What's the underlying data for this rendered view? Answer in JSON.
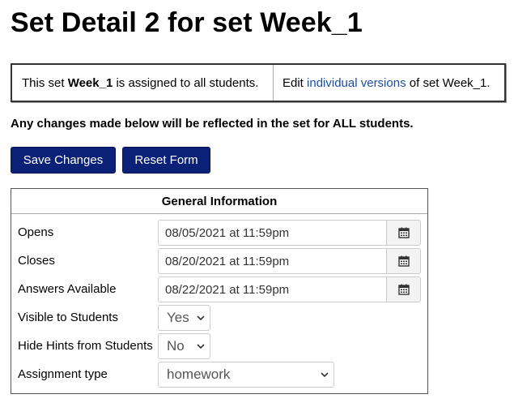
{
  "page": {
    "title": "Set Detail 2 for set Week_1"
  },
  "assignment": {
    "text_before": "This set ",
    "set_name": "Week_1",
    "text_after": " is assigned to all students.",
    "edit_prefix": "Edit ",
    "edit_link": "individual versions",
    "edit_suffix": " of set Week_1."
  },
  "notice": "Any changes made below will be reflected in the set for ALL students.",
  "buttons": {
    "save": "Save Changes",
    "reset": "Reset Form"
  },
  "general_info": {
    "header": "General Information",
    "opens": {
      "label": "Opens",
      "value": "08/05/2021 at 11:59pm"
    },
    "closes": {
      "label": "Closes",
      "value": "08/20/2021 at 11:59pm"
    },
    "answers": {
      "label": "Answers Available",
      "value": "08/22/2021 at 11:59pm"
    },
    "visible": {
      "label": "Visible to Students",
      "value": "Yes"
    },
    "hide_hints": {
      "label": "Hide Hints from Students",
      "value": "No"
    },
    "assignment_type": {
      "label": "Assignment type",
      "value": "homework"
    }
  },
  "icons": {
    "calendar": "calendar-icon",
    "chevron": "chevron-down-icon"
  }
}
